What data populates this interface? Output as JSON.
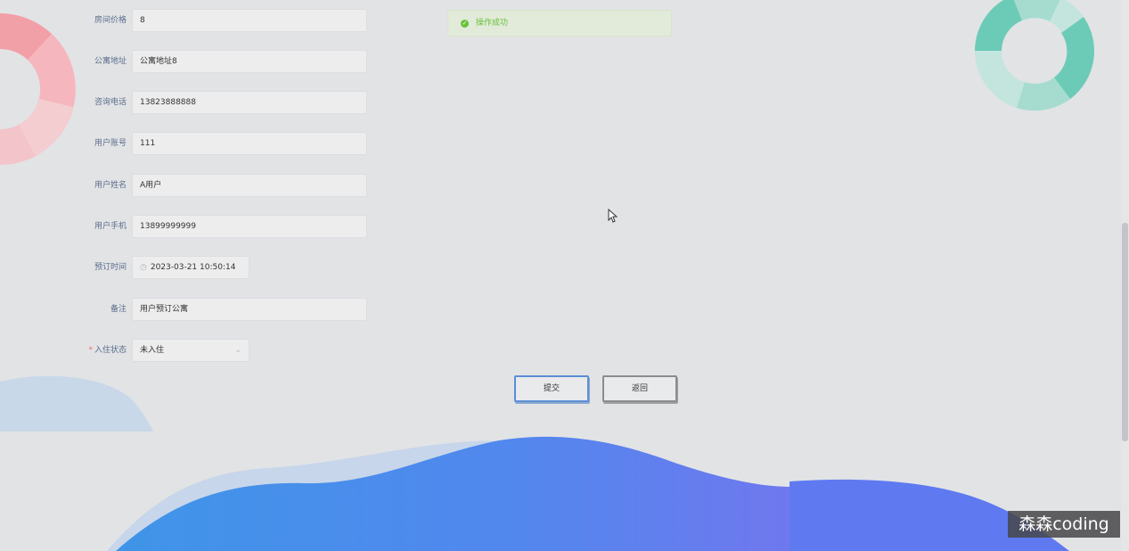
{
  "form": {
    "fields": [
      {
        "label": "房间价格",
        "value": "8"
      },
      {
        "label": "公寓地址",
        "value": "公寓地址8"
      },
      {
        "label": "咨询电话",
        "value": "13823888888"
      },
      {
        "label": "用户账号",
        "value": "111"
      },
      {
        "label": "用户姓名",
        "value": "A用户"
      },
      {
        "label": "用户手机",
        "value": "13899999999"
      },
      {
        "label": "预订时间",
        "value": "2023-03-21 10:50:14"
      },
      {
        "label": "备注",
        "value": "用户预订公寓"
      },
      {
        "label": "入住状态",
        "value": "未入住",
        "required_mark": "*"
      }
    ]
  },
  "toast": {
    "message": "操作成功"
  },
  "buttons": {
    "submit": "提交",
    "back": "返回"
  },
  "watermark": "森森coding",
  "colors": {
    "success": "#67c23a",
    "primary_border": "#5b8fd6",
    "wave_blue": "#4c86ee",
    "donut_green": "#6ccbb7",
    "donut_red": "#f29ca4"
  },
  "icons": {
    "date": "clock-icon",
    "select": "chevron-down-icon",
    "toast": "check-circle-icon"
  }
}
